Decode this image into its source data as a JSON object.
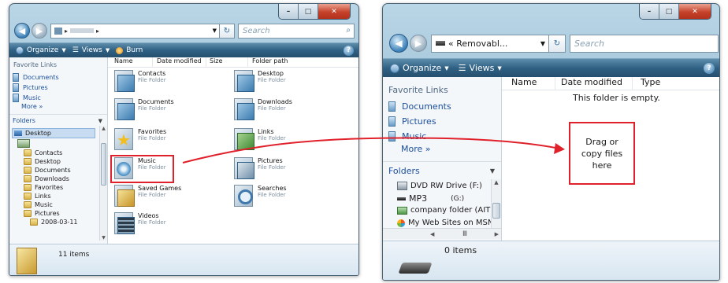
{
  "left_window": {
    "search_placeholder": "Search",
    "toolbar": {
      "organize": "Organize",
      "views": "Views",
      "burn": "Burn"
    },
    "favorites_title": "Favorite Links",
    "favorites": [
      "Documents",
      "Pictures",
      "Music"
    ],
    "more_label": "More »",
    "folders_label": "Folders",
    "tree": [
      "Desktop",
      "Contacts",
      "Desktop",
      "Documents",
      "Downloads",
      "Favorites",
      "Links",
      "Music",
      "Pictures",
      "2008-03-11"
    ],
    "columns": [
      "Name",
      "Date modified",
      "Size",
      "Folder path"
    ],
    "items": [
      {
        "name": "Contacts",
        "sub": "File Folder"
      },
      {
        "name": "Desktop",
        "sub": "File Folder"
      },
      {
        "name": "Documents",
        "sub": "File Folder"
      },
      {
        "name": "Downloads",
        "sub": "File Folder"
      },
      {
        "name": "Favorites",
        "sub": "File Folder"
      },
      {
        "name": "Links",
        "sub": "File Folder"
      },
      {
        "name": "Music",
        "sub": "File Folder"
      },
      {
        "name": "Pictures",
        "sub": "File Folder"
      },
      {
        "name": "Saved Games",
        "sub": "File Folder"
      },
      {
        "name": "Searches",
        "sub": "File Folder"
      },
      {
        "name": "Videos",
        "sub": "File Folder"
      }
    ],
    "status": "11 items"
  },
  "right_window": {
    "address": "« Removabl...",
    "search_placeholder": "Search",
    "toolbar": {
      "organize": "Organize",
      "views": "Views"
    },
    "favorites_title": "Favorite Links",
    "favorites": [
      "Documents",
      "Pictures",
      "Music"
    ],
    "more_label": "More »",
    "folders_label": "Folders",
    "drives": [
      {
        "name": "DVD RW Drive (F:)",
        "letter": ""
      },
      {
        "name": "MP3",
        "letter": "(G:)"
      },
      {
        "name": "company folder (AIT)",
        "letter": ""
      },
      {
        "name": "My Web Sites on MSN",
        "letter": ""
      }
    ],
    "scroll_label": "III",
    "columns": [
      "Name",
      "Date modified",
      "Type"
    ],
    "empty_text": "This folder is empty.",
    "status": "0 items"
  },
  "callout": {
    "line1": "Drag or",
    "line2": "copy files",
    "line3": "here"
  },
  "colors": {
    "accent_red": "#e0202a",
    "toolbar": "#2f6184",
    "link_blue": "#1a4e9a"
  }
}
